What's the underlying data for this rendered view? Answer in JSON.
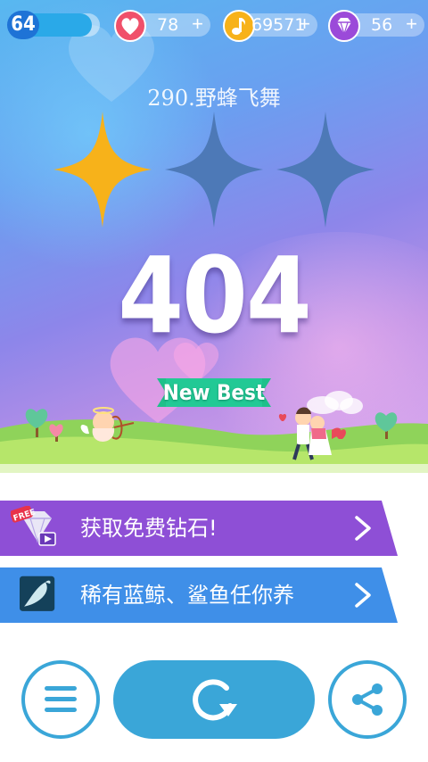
{
  "status_bar": {
    "level": "64",
    "level_progress": 0.9,
    "hearts": {
      "value": "78",
      "plus": "+",
      "icon": "heart-icon"
    },
    "notes": {
      "value": "69571",
      "plus": "+",
      "icon": "music-note-icon"
    },
    "gems": {
      "value": "56",
      "plus": "+",
      "icon": "diamond-icon"
    }
  },
  "result": {
    "song_title": "290.野蜂飞舞",
    "stars_earned": 1,
    "stars_total": 3,
    "score": "404",
    "badge": "New Best"
  },
  "promos": [
    {
      "text": "获取免费钻石!",
      "icon": "free-diamond-video-icon",
      "icon_badge": "FREE",
      "color": "#8e4fd6"
    },
    {
      "text": "稀有蓝鲸、鲨鱼任你养",
      "icon": "whale-icon",
      "color": "#3f8fe8"
    }
  ],
  "buttons": {
    "menu": "menu-icon",
    "replay": "replay-icon",
    "share": "share-icon"
  },
  "colors": {
    "accent": "#3aa6d8",
    "star_gold": "#f7b21a",
    "star_empty": "#4d79b7",
    "banner_green": "#1ec08a"
  }
}
